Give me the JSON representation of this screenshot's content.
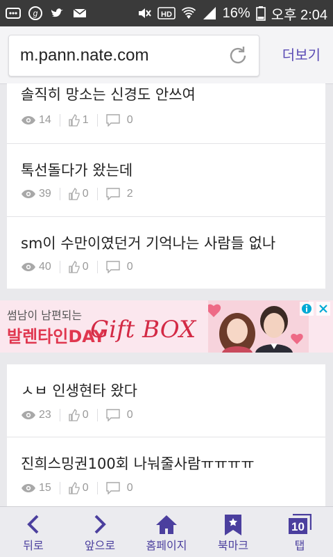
{
  "status_bar": {
    "battery": "16%",
    "time": "오후 2:04",
    "network": "HD"
  },
  "browser": {
    "url": "m.pann.nate.com",
    "more_label": "더보기"
  },
  "posts_group1": [
    {
      "title": "솔직히 망소는 신경도 안쓰여",
      "views": "14",
      "likes": "1",
      "comments": "0"
    },
    {
      "title": "톡선돌다가 왔는데",
      "views": "39",
      "likes": "0",
      "comments": "2"
    },
    {
      "title": "sm이 수만이였던거 기억나는 사람들 없나",
      "views": "40",
      "likes": "0",
      "comments": "0"
    }
  ],
  "ad": {
    "line1": "썸남이 남편되는",
    "line2": "발렌타인DAY",
    "gift": "Gift BOX"
  },
  "posts_group2": [
    {
      "title": "ㅅㅂ 인생현타 왔다",
      "views": "23",
      "likes": "0",
      "comments": "0"
    },
    {
      "title": "진희스밍권100회 나눠줄사람ㅠㅠㅠㅠ",
      "views": "15",
      "likes": "0",
      "comments": "0"
    }
  ],
  "bottom_nav": [
    {
      "label": "뒤로",
      "icon": "back-arrow-icon"
    },
    {
      "label": "앞으로",
      "icon": "forward-arrow-icon"
    },
    {
      "label": "홈페이지",
      "icon": "home-icon"
    },
    {
      "label": "북마크",
      "icon": "bookmark-icon"
    },
    {
      "label": "탭",
      "icon": "tabs-icon",
      "count": "10"
    }
  ],
  "colors": {
    "accent": "#5a4bb4",
    "status_bar": "#3a3a3a"
  }
}
